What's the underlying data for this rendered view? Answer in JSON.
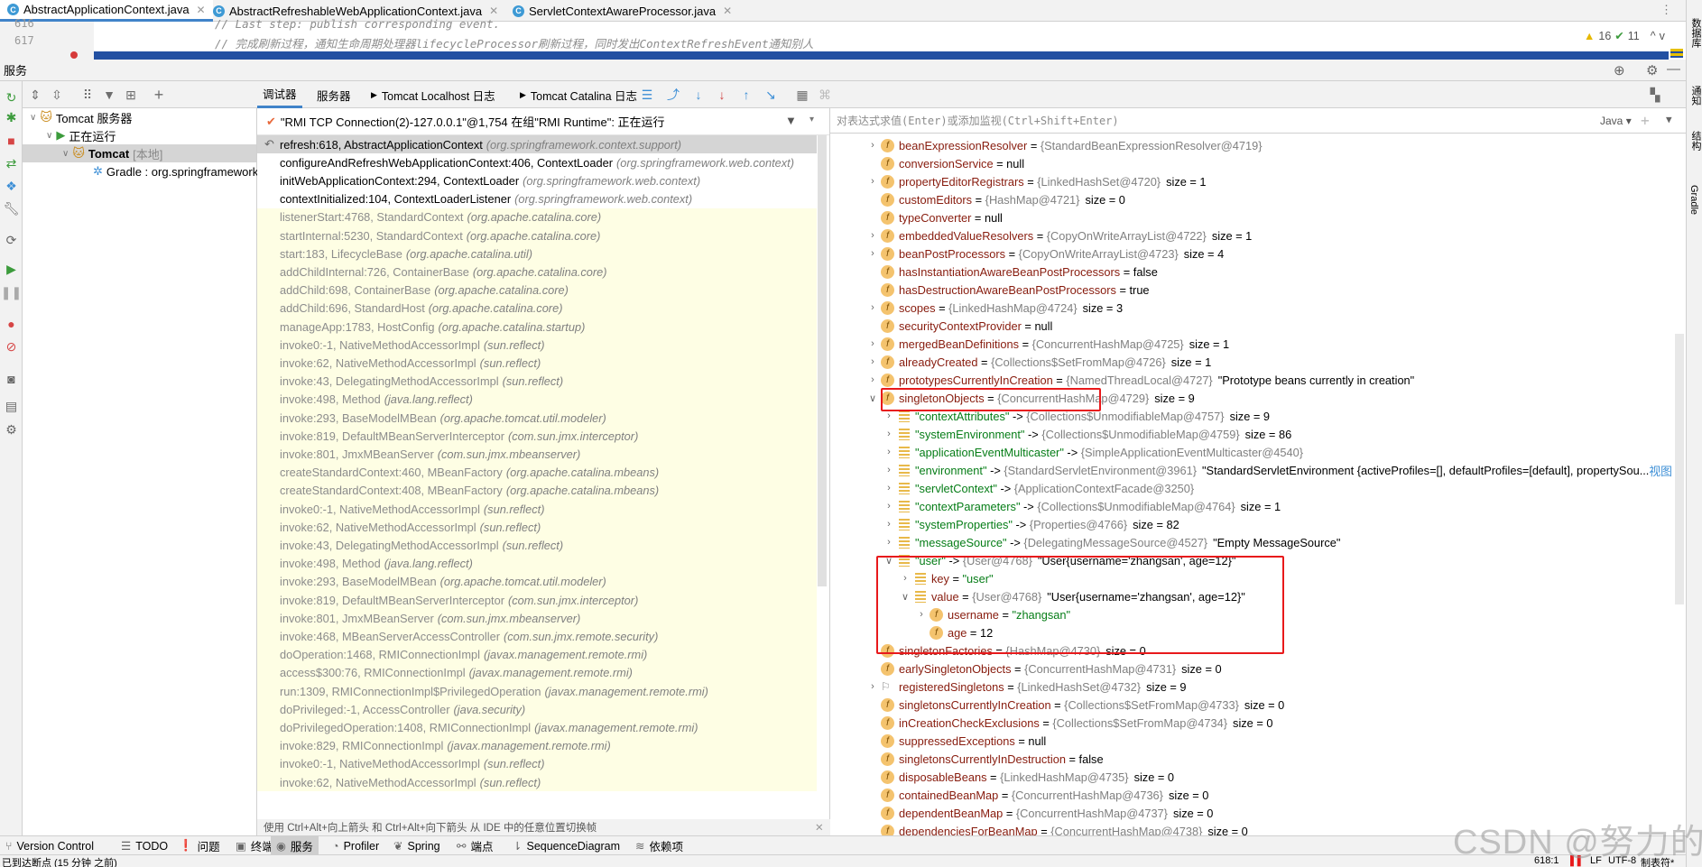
{
  "editor_tabs": [
    {
      "label": "AbstractApplicationContext.java",
      "active": true
    },
    {
      "label": "AbstractRefreshableWebApplicationContext.java",
      "active": false
    },
    {
      "label": "ServletContextAwareProcessor.java",
      "active": false
    }
  ],
  "editor": {
    "lines": [
      {
        "num": "616",
        "text": "// Last step: publish corresponding event."
      },
      {
        "num": "617",
        "text": "// 完成刷新过程，通知生命周期处理器lifecycleProcessor刷新过程，同时发出ContextRefreshEvent通知别人"
      }
    ],
    "warnings": "16",
    "checks": "11"
  },
  "services_panel": {
    "title": "服务",
    "tree": [
      {
        "label": "Tomcat 服务器",
        "level": 0,
        "expanded": true
      },
      {
        "label": "正在运行",
        "level": 1,
        "expanded": true
      },
      {
        "label": "Tomcat",
        "suffix": "[本地]",
        "level": 2,
        "expanded": true,
        "selected": true
      },
      {
        "label": "Gradle : org.springframework",
        "level": 3
      }
    ]
  },
  "debugger": {
    "tabs": [
      "调试器",
      "服务器",
      "Tomcat Localhost 日志",
      "Tomcat Catalina 日志"
    ],
    "thread": "\"RMI TCP Connection(2)-127.0.0.1\"@1,754 在组\"RMI Runtime\": 正在运行",
    "frames": [
      {
        "frame": "refresh:618, AbstractApplicationContext",
        "pkg": "(org.springframework.context.support)",
        "kind": "sel"
      },
      {
        "frame": "configureAndRefreshWebApplicationContext:406, ContextLoader",
        "pkg": "(org.springframework.web.context)",
        "kind": "app"
      },
      {
        "frame": "initWebApplicationContext:294, ContextLoader",
        "pkg": "(org.springframework.web.context)",
        "kind": "app"
      },
      {
        "frame": "contextInitialized:104, ContextLoaderListener",
        "pkg": "(org.springframework.web.context)",
        "kind": "app"
      },
      {
        "frame": "listenerStart:4768, StandardContext",
        "pkg": "(org.apache.catalina.core)",
        "kind": "lib"
      },
      {
        "frame": "startInternal:5230, StandardContext",
        "pkg": "(org.apache.catalina.core)",
        "kind": "lib"
      },
      {
        "frame": "start:183, LifecycleBase",
        "pkg": "(org.apache.catalina.util)",
        "kind": "lib"
      },
      {
        "frame": "addChildInternal:726, ContainerBase",
        "pkg": "(org.apache.catalina.core)",
        "kind": "lib"
      },
      {
        "frame": "addChild:698, ContainerBase",
        "pkg": "(org.apache.catalina.core)",
        "kind": "lib"
      },
      {
        "frame": "addChild:696, StandardHost",
        "pkg": "(org.apache.catalina.core)",
        "kind": "lib"
      },
      {
        "frame": "manageApp:1783, HostConfig",
        "pkg": "(org.apache.catalina.startup)",
        "kind": "lib"
      },
      {
        "frame": "invoke0:-1, NativeMethodAccessorImpl",
        "pkg": "(sun.reflect)",
        "kind": "lib"
      },
      {
        "frame": "invoke:62, NativeMethodAccessorImpl",
        "pkg": "(sun.reflect)",
        "kind": "lib"
      },
      {
        "frame": "invoke:43, DelegatingMethodAccessorImpl",
        "pkg": "(sun.reflect)",
        "kind": "lib"
      },
      {
        "frame": "invoke:498, Method",
        "pkg": "(java.lang.reflect)",
        "kind": "lib"
      },
      {
        "frame": "invoke:293, BaseModelMBean",
        "pkg": "(org.apache.tomcat.util.modeler)",
        "kind": "lib"
      },
      {
        "frame": "invoke:819, DefaultMBeanServerInterceptor",
        "pkg": "(com.sun.jmx.interceptor)",
        "kind": "lib"
      },
      {
        "frame": "invoke:801, JmxMBeanServer",
        "pkg": "(com.sun.jmx.mbeanserver)",
        "kind": "lib"
      },
      {
        "frame": "createStandardContext:460, MBeanFactory",
        "pkg": "(org.apache.catalina.mbeans)",
        "kind": "lib"
      },
      {
        "frame": "createStandardContext:408, MBeanFactory",
        "pkg": "(org.apache.catalina.mbeans)",
        "kind": "lib"
      },
      {
        "frame": "invoke0:-1, NativeMethodAccessorImpl",
        "pkg": "(sun.reflect)",
        "kind": "lib"
      },
      {
        "frame": "invoke:62, NativeMethodAccessorImpl",
        "pkg": "(sun.reflect)",
        "kind": "lib"
      },
      {
        "frame": "invoke:43, DelegatingMethodAccessorImpl",
        "pkg": "(sun.reflect)",
        "kind": "lib"
      },
      {
        "frame": "invoke:498, Method",
        "pkg": "(java.lang.reflect)",
        "kind": "lib"
      },
      {
        "frame": "invoke:293, BaseModelMBean",
        "pkg": "(org.apache.tomcat.util.modeler)",
        "kind": "lib"
      },
      {
        "frame": "invoke:819, DefaultMBeanServerInterceptor",
        "pkg": "(com.sun.jmx.interceptor)",
        "kind": "lib"
      },
      {
        "frame": "invoke:801, JmxMBeanServer",
        "pkg": "(com.sun.jmx.mbeanserver)",
        "kind": "lib"
      },
      {
        "frame": "invoke:468, MBeanServerAccessController",
        "pkg": "(com.sun.jmx.remote.security)",
        "kind": "lib"
      },
      {
        "frame": "doOperation:1468, RMIConnectionImpl",
        "pkg": "(javax.management.remote.rmi)",
        "kind": "lib"
      },
      {
        "frame": "access$300:76, RMIConnectionImpl",
        "pkg": "(javax.management.remote.rmi)",
        "kind": "lib"
      },
      {
        "frame": "run:1309, RMIConnectionImpl$PrivilegedOperation",
        "pkg": "(javax.management.remote.rmi)",
        "kind": "lib"
      },
      {
        "frame": "doPrivileged:-1, AccessController",
        "pkg": "(java.security)",
        "kind": "lib"
      },
      {
        "frame": "doPrivilegedOperation:1408, RMIConnectionImpl",
        "pkg": "(javax.management.remote.rmi)",
        "kind": "lib"
      },
      {
        "frame": "invoke:829, RMIConnectionImpl",
        "pkg": "(javax.management.remote.rmi)",
        "kind": "lib"
      },
      {
        "frame": "invoke0:-1, NativeMethodAccessorImpl",
        "pkg": "(sun.reflect)",
        "kind": "lib"
      },
      {
        "frame": "invoke:62, NativeMethodAccessorImpl",
        "pkg": "(sun.reflect)",
        "kind": "lib"
      }
    ],
    "hint": "使用 Ctrl+Alt+向上箭头 和 Ctrl+Alt+向下箭头 从 IDE 中的任意位置切换帧"
  },
  "variables": {
    "eval_placeholder": "对表达式求值(Enter)或添加监视(Ctrl+Shift+Enter)",
    "language": "Java",
    "rows": [
      {
        "level": 0,
        "exp": ">",
        "icon": "field",
        "name": "beanExpressionResolver",
        "sep": " = ",
        "type": "{StandardBeanExpressionResolver@4719}",
        "val": ""
      },
      {
        "level": 0,
        "exp": "",
        "icon": "field",
        "name": "conversionService",
        "sep": " = ",
        "type": "",
        "val": "null"
      },
      {
        "level": 0,
        "exp": ">",
        "icon": "field",
        "name": "propertyEditorRegistrars",
        "sep": " = ",
        "type": "{LinkedHashSet@4720}",
        "val": "size = 1"
      },
      {
        "level": 0,
        "exp": "",
        "icon": "field",
        "name": "customEditors",
        "sep": " = ",
        "type": "{HashMap@4721}",
        "val": "size = 0"
      },
      {
        "level": 0,
        "exp": "",
        "icon": "field",
        "name": "typeConverter",
        "sep": " = ",
        "type": "",
        "val": "null"
      },
      {
        "level": 0,
        "exp": ">",
        "icon": "field",
        "name": "embeddedValueResolvers",
        "sep": " = ",
        "type": "{CopyOnWriteArrayList@4722}",
        "val": "size = 1"
      },
      {
        "level": 0,
        "exp": ">",
        "icon": "field",
        "name": "beanPostProcessors",
        "sep": " = ",
        "type": "{CopyOnWriteArrayList@4723}",
        "val": "size = 4"
      },
      {
        "level": 0,
        "exp": "",
        "icon": "field",
        "name": "hasInstantiationAwareBeanPostProcessors",
        "sep": " = ",
        "type": "",
        "val": "false"
      },
      {
        "level": 0,
        "exp": "",
        "icon": "field",
        "name": "hasDestructionAwareBeanPostProcessors",
        "sep": " = ",
        "type": "",
        "val": "true"
      },
      {
        "level": 0,
        "exp": ">",
        "icon": "field",
        "name": "scopes",
        "sep": " = ",
        "type": "{LinkedHashMap@4724}",
        "val": "size = 3"
      },
      {
        "level": 0,
        "exp": "",
        "icon": "field",
        "name": "securityContextProvider",
        "sep": " = ",
        "type": "",
        "val": "null"
      },
      {
        "level": 0,
        "exp": ">",
        "icon": "field",
        "name": "mergedBeanDefinitions",
        "sep": " = ",
        "type": "{ConcurrentHashMap@4725}",
        "val": "size = 1"
      },
      {
        "level": 0,
        "exp": ">",
        "icon": "field",
        "name": "alreadyCreated",
        "sep": " = ",
        "type": "{Collections$SetFromMap@4726}",
        "val": "size = 1"
      },
      {
        "level": 0,
        "exp": ">",
        "icon": "field",
        "name": "prototypesCurrentlyInCreation",
        "sep": " = ",
        "type": "{NamedThreadLocal@4727}",
        "val": "\"Prototype beans currently in creation\""
      },
      {
        "level": 0,
        "exp": "v",
        "icon": "field",
        "name": "singletonObjects",
        "sep": " = ",
        "type": "{ConcurrentHashMap@4729}",
        "val": "size = 9"
      },
      {
        "level": 1,
        "exp": ">",
        "icon": "entry",
        "key": "\"contextAttributes\"",
        "sep": " -> ",
        "type": "{Collections$UnmodifiableMap@4757}",
        "val": "size = 9"
      },
      {
        "level": 1,
        "exp": ">",
        "icon": "entry",
        "key": "\"systemEnvironment\"",
        "sep": " -> ",
        "type": "{Collections$UnmodifiableMap@4759}",
        "val": "size = 86"
      },
      {
        "level": 1,
        "exp": ">",
        "icon": "entry",
        "key": "\"applicationEventMulticaster\"",
        "sep": " -> ",
        "type": "{SimpleApplicationEventMulticaster@4540}",
        "val": ""
      },
      {
        "level": 1,
        "exp": ">",
        "icon": "entry",
        "key": "\"environment\"",
        "sep": " -> ",
        "type": "{StandardServletEnvironment@3961}",
        "val": "\"StandardServletEnvironment {activeProfiles=[], defaultProfiles=[default], propertySou...",
        "link": "视图"
      },
      {
        "level": 1,
        "exp": ">",
        "icon": "entry",
        "key": "\"servletContext\"",
        "sep": " -> ",
        "type": "{ApplicationContextFacade@3250}",
        "val": ""
      },
      {
        "level": 1,
        "exp": ">",
        "icon": "entry",
        "key": "\"contextParameters\"",
        "sep": " -> ",
        "type": "{Collections$UnmodifiableMap@4764}",
        "val": "size = 1"
      },
      {
        "level": 1,
        "exp": ">",
        "icon": "entry",
        "key": "\"systemProperties\"",
        "sep": " -> ",
        "type": "{Properties@4766}",
        "val": "size = 82"
      },
      {
        "level": 1,
        "exp": ">",
        "icon": "entry",
        "key": "\"messageSource\"",
        "sep": " -> ",
        "type": "{DelegatingMessageSource@4527}",
        "val": "\"Empty MessageSource\""
      },
      {
        "level": 1,
        "exp": "v",
        "icon": "entry",
        "key": "\"user\"",
        "sep": " -> ",
        "type": "{User@4768}",
        "val": "\"User{username='zhangsan', age=12}\""
      },
      {
        "level": 2,
        "exp": ">",
        "icon": "entry",
        "name": "key",
        "sep": " = ",
        "type": "",
        "str": "\"user\""
      },
      {
        "level": 2,
        "exp": "v",
        "icon": "entry",
        "name": "value",
        "sep": " = ",
        "type": "{User@4768}",
        "val": "\"User{username='zhangsan', age=12}\""
      },
      {
        "level": 3,
        "exp": ">",
        "icon": "field",
        "name": "username",
        "sep": " = ",
        "type": "",
        "str": "\"zhangsan\""
      },
      {
        "level": 3,
        "exp": "",
        "icon": "field",
        "name": "age",
        "sep": " = ",
        "type": "",
        "val": "12"
      },
      {
        "level": 0,
        "exp": "",
        "icon": "field",
        "name": "singletonFactories",
        "sep": " = ",
        "type": "{HashMap@4730}",
        "val": "size = 0"
      },
      {
        "level": 0,
        "exp": "",
        "icon": "field",
        "name": "earlySingletonObjects",
        "sep": " = ",
        "type": "{ConcurrentHashMap@4731}",
        "val": "size = 0"
      },
      {
        "level": 0,
        "exp": ">",
        "icon": "flag",
        "name": "registeredSingletons",
        "sep": " = ",
        "type": "{LinkedHashSet@4732}",
        "val": "size = 9"
      },
      {
        "level": 0,
        "exp": "",
        "icon": "field",
        "name": "singletonsCurrentlyInCreation",
        "sep": " = ",
        "type": "{Collections$SetFromMap@4733}",
        "val": "size = 0"
      },
      {
        "level": 0,
        "exp": "",
        "icon": "field",
        "name": "inCreationCheckExclusions",
        "sep": " = ",
        "type": "{Collections$SetFromMap@4734}",
        "val": "size = 0"
      },
      {
        "level": 0,
        "exp": "",
        "icon": "field",
        "name": "suppressedExceptions",
        "sep": " = ",
        "type": "",
        "val": "null"
      },
      {
        "level": 0,
        "exp": "",
        "icon": "field",
        "name": "singletonsCurrentlyInDestruction",
        "sep": " = ",
        "type": "",
        "val": "false"
      },
      {
        "level": 0,
        "exp": "",
        "icon": "field",
        "name": "disposableBeans",
        "sep": " = ",
        "type": "{LinkedHashMap@4735}",
        "val": "size = 0"
      },
      {
        "level": 0,
        "exp": "",
        "icon": "field",
        "name": "containedBeanMap",
        "sep": " = ",
        "type": "{ConcurrentHashMap@4736}",
        "val": "size = 0"
      },
      {
        "level": 0,
        "exp": "",
        "icon": "field",
        "name": "dependentBeanMap",
        "sep": " = ",
        "type": "{ConcurrentHashMap@4737}",
        "val": "size = 0"
      },
      {
        "level": 0,
        "exp": "",
        "icon": "field",
        "name": "dependenciesForBeanMap",
        "sep": " = ",
        "type": "{ConcurrentHashMap@4738}",
        "val": "size = 0"
      }
    ]
  },
  "bottom_bar": [
    {
      "label": "Version Control",
      "icon": "branch-icon"
    },
    {
      "label": "TODO",
      "icon": "list-icon"
    },
    {
      "label": "问题",
      "icon": "problems-icon"
    },
    {
      "label": "终端",
      "icon": "terminal-icon"
    },
    {
      "label": "服务",
      "icon": "services-icon",
      "active": true
    },
    {
      "label": "Profiler",
      "icon": "profiler-icon"
    },
    {
      "label": "Spring",
      "icon": "spring-icon"
    },
    {
      "label": "端点",
      "icon": "endpoints-icon"
    },
    {
      "label": "SequenceDiagram",
      "icon": "sequence-icon"
    },
    {
      "label": "依赖项",
      "icon": "dependencies-icon"
    }
  ],
  "status": {
    "message": "已到达断点 (15 分钟 之前)",
    "position": "618:1",
    "line_sep": "LF",
    "encoding": "UTF-8",
    "indent": "制表符*",
    "extra": "0"
  },
  "right_strip": [
    "数据库",
    "通知",
    "结构",
    "Gradle"
  ],
  "watermark": "CSDN @努力的布布",
  "colors": {
    "accent": "#4083c9",
    "current_line": "#2350a2",
    "highlight_box": "#e8191b",
    "lib_frame_bg": "#fefee4"
  }
}
